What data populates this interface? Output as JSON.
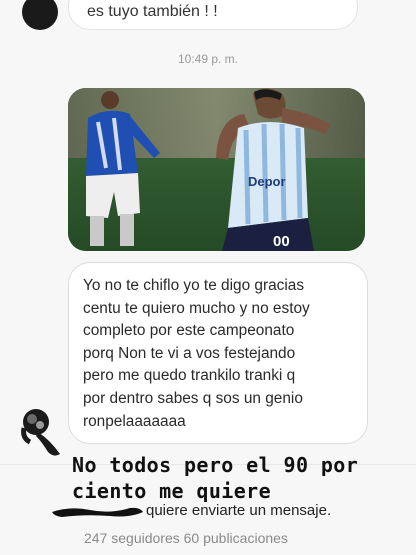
{
  "thread": {
    "previous_message": "es tuyo también ! !",
    "timestamp": "10:49 p. m.",
    "photo_name": "celebration-photo",
    "message_lines": [
      "Yo no te chiflo yo te digo gracias",
      "centu te quiero mucho y no estoy",
      "completo por este campeonato",
      "porq Non te vi a vos festejando",
      "pero me quedo trankilo tranki q",
      "por dentro sabes q sos un genio",
      "ronpelaaaaaaa"
    ]
  },
  "caption": {
    "line1": "No todos pero el 90 por",
    "line2": "ciento me quiere"
  },
  "request": {
    "text": "quiere enviarte un mensaje.",
    "stats": "247 seguidores 60 publicaciones"
  },
  "icons": {
    "sender_avatar": "avatar-icon",
    "redaction": "scribble-redaction"
  },
  "colors": {
    "background": "#f7f7f7",
    "bubble": "#ffffff",
    "bubble_border": "#dcdcdc",
    "timestamp": "#9a9a9a",
    "stats": "#8a8a8a"
  }
}
